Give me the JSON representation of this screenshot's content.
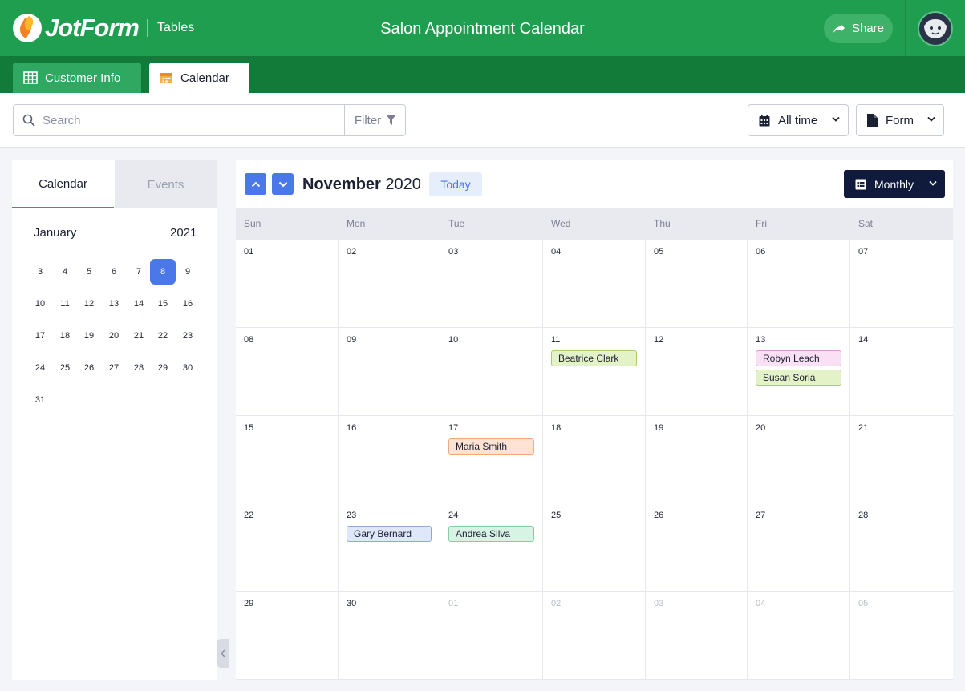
{
  "header": {
    "logo_text": "JotForm",
    "section": "Tables",
    "title": "Salon Appointment Calendar",
    "share_label": "Share"
  },
  "tabs": [
    {
      "label": "Customer Info",
      "icon": "table-grid-icon"
    },
    {
      "label": "Calendar",
      "icon": "calendar-icon",
      "active": true
    }
  ],
  "toolbar": {
    "search_placeholder": "Search",
    "filter_label": "Filter",
    "time_range": "All time",
    "form_label": "Form"
  },
  "sidebar": {
    "tabs": {
      "calendar": "Calendar",
      "events": "Events"
    },
    "month": "January",
    "year": "2021",
    "selected_day": "8",
    "weeks": [
      [
        "3",
        "4",
        "5",
        "6",
        "7",
        "8",
        "9"
      ],
      [
        "10",
        "11",
        "12",
        "13",
        "14",
        "15",
        "16"
      ],
      [
        "17",
        "18",
        "19",
        "20",
        "21",
        "22",
        "23"
      ],
      [
        "24",
        "25",
        "26",
        "27",
        "28",
        "29",
        "30"
      ],
      [
        "31"
      ]
    ]
  },
  "calendar": {
    "month": "November",
    "year": "2020",
    "today_label": "Today",
    "view_label": "Monthly",
    "weekdays": [
      "Sun",
      "Mon",
      "Tue",
      "Wed",
      "Thu",
      "Fri",
      "Sat"
    ],
    "weeks": [
      [
        {
          "d": "01"
        },
        {
          "d": "02"
        },
        {
          "d": "03"
        },
        {
          "d": "04"
        },
        {
          "d": "05"
        },
        {
          "d": "06"
        },
        {
          "d": "07"
        }
      ],
      [
        {
          "d": "08"
        },
        {
          "d": "09"
        },
        {
          "d": "10"
        },
        {
          "d": "11"
        },
        {
          "d": "12"
        },
        {
          "d": "13"
        },
        {
          "d": "14"
        }
      ],
      [
        {
          "d": "15"
        },
        {
          "d": "16"
        },
        {
          "d": "17"
        },
        {
          "d": "18"
        },
        {
          "d": "19"
        },
        {
          "d": "20"
        },
        {
          "d": "21"
        }
      ],
      [
        {
          "d": "22"
        },
        {
          "d": "23"
        },
        {
          "d": "24"
        },
        {
          "d": "25"
        },
        {
          "d": "26"
        },
        {
          "d": "27"
        },
        {
          "d": "28"
        }
      ],
      [
        {
          "d": "29"
        },
        {
          "d": "30"
        },
        {
          "d": "01",
          "other": true
        },
        {
          "d": "02",
          "other": true
        },
        {
          "d": "03",
          "other": true
        },
        {
          "d": "04",
          "other": true
        },
        {
          "d": "05",
          "other": true
        }
      ]
    ],
    "events": [
      {
        "week": 1,
        "day": 3,
        "slot": 0,
        "name": "Beatrice Clark",
        "bg": "#e4f2c8",
        "border": "#a9cc6e"
      },
      {
        "week": 1,
        "day": 5,
        "slot": 0,
        "name": "Robyn Leach",
        "bg": "#f9e0f5",
        "border": "#dd9ad5"
      },
      {
        "week": 1,
        "day": 5,
        "slot": 1,
        "name": "Susan Soria",
        "bg": "#e4f2c8",
        "border": "#a9cc6e"
      },
      {
        "week": 2,
        "day": 2,
        "slot": 0,
        "name": "Maria Smith",
        "bg": "#fde3d3",
        "border": "#f0a97c"
      },
      {
        "week": 3,
        "day": 1,
        "slot": 0,
        "name": "Gary Bernard",
        "bg": "#dfe8f8",
        "border": "#8ea8d8"
      },
      {
        "week": 3,
        "day": 2,
        "slot": 0,
        "name": "Andrea Silva",
        "bg": "#d8f3e3",
        "border": "#83cfa2"
      }
    ]
  }
}
